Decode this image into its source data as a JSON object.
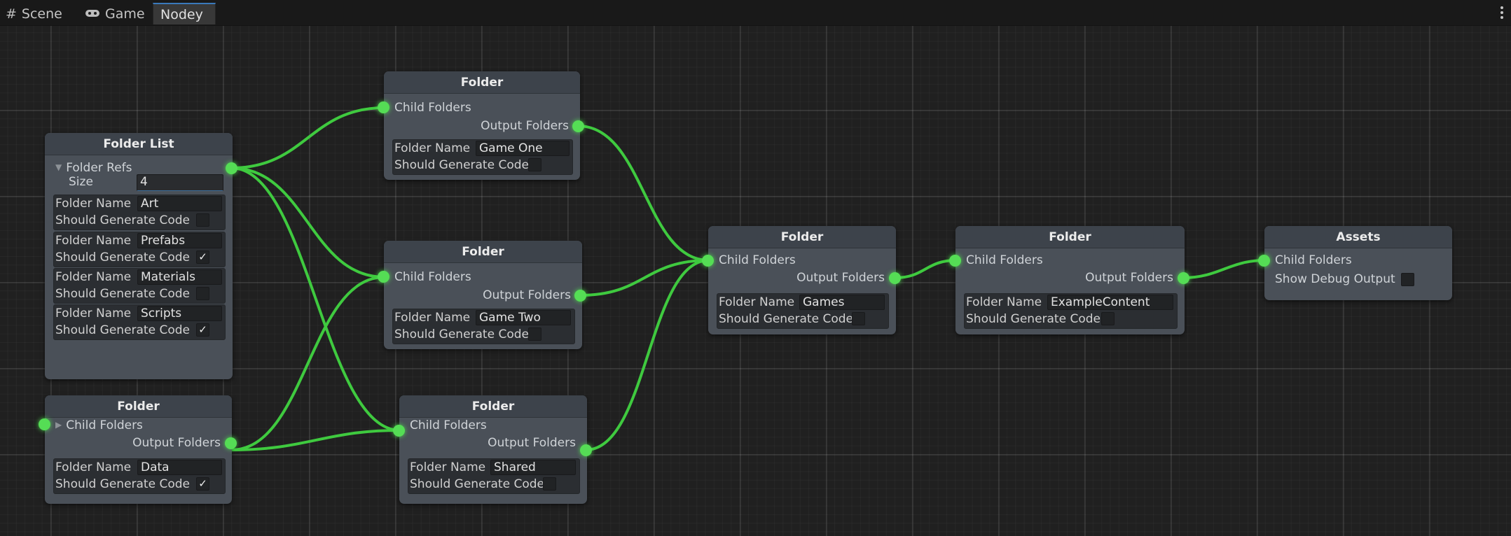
{
  "tabs": [
    {
      "label": "Scene",
      "icon": "grid-icon"
    },
    {
      "label": "Game",
      "icon": "gamepad-icon"
    },
    {
      "label": "Nodey",
      "icon": ""
    }
  ],
  "active_tab": "Nodey",
  "accent_colors": {
    "connection": "#55dd55",
    "tab_highlight": "#3a79bb"
  },
  "nodes": {
    "folder_list": {
      "title": "Folder List",
      "folder_refs_label": "Folder Refs",
      "size_label": "Size",
      "size_value": "4",
      "items": [
        {
          "name_label": "Folder Name",
          "name_value": "Art",
          "gen_label": "Should Generate Code",
          "gen_value": ""
        },
        {
          "name_label": "Folder Name",
          "name_value": "Prefabs",
          "gen_label": "Should Generate Code",
          "gen_value": "✓"
        },
        {
          "name_label": "Folder Name",
          "name_value": "Materials",
          "gen_label": "Should Generate Code",
          "gen_value": ""
        },
        {
          "name_label": "Folder Name",
          "name_value": "Scripts",
          "gen_label": "Should Generate Code",
          "gen_value": "✓"
        }
      ]
    },
    "folder_data": {
      "title": "Folder",
      "child_label": "Child Folders",
      "output_label": "Output Folders",
      "name_label": "Folder Name",
      "name_value": "Data",
      "gen_label": "Should Generate Code",
      "gen_value": "✓"
    },
    "folder_game_one": {
      "title": "Folder",
      "child_label": "Child Folders",
      "output_label": "Output Folders",
      "name_label": "Folder Name",
      "name_value": "Game One",
      "gen_label": "Should Generate Code",
      "gen_value": ""
    },
    "folder_game_two": {
      "title": "Folder",
      "child_label": "Child Folders",
      "output_label": "Output Folders",
      "name_label": "Folder Name",
      "name_value": "Game Two",
      "gen_label": "Should Generate Code",
      "gen_value": ""
    },
    "folder_shared": {
      "title": "Folder",
      "child_label": "Child Folders",
      "output_label": "Output Folders",
      "name_label": "Folder Name",
      "name_value": "Shared",
      "gen_label": "Should Generate Code",
      "gen_value": ""
    },
    "folder_games": {
      "title": "Folder",
      "child_label": "Child Folders",
      "output_label": "Output Folders",
      "name_label": "Folder Name",
      "name_value": "Games",
      "gen_label": "Should Generate Code",
      "gen_value": ""
    },
    "folder_example": {
      "title": "Folder",
      "child_label": "Child Folders",
      "output_label": "Output Folders",
      "name_label": "Folder Name",
      "name_value": "ExampleContent",
      "gen_label": "Should Generate Code",
      "gen_value": ""
    },
    "assets": {
      "title": "Assets",
      "child_label": "Child Folders",
      "debug_label": "Show Debug Output",
      "debug_value": ""
    }
  }
}
